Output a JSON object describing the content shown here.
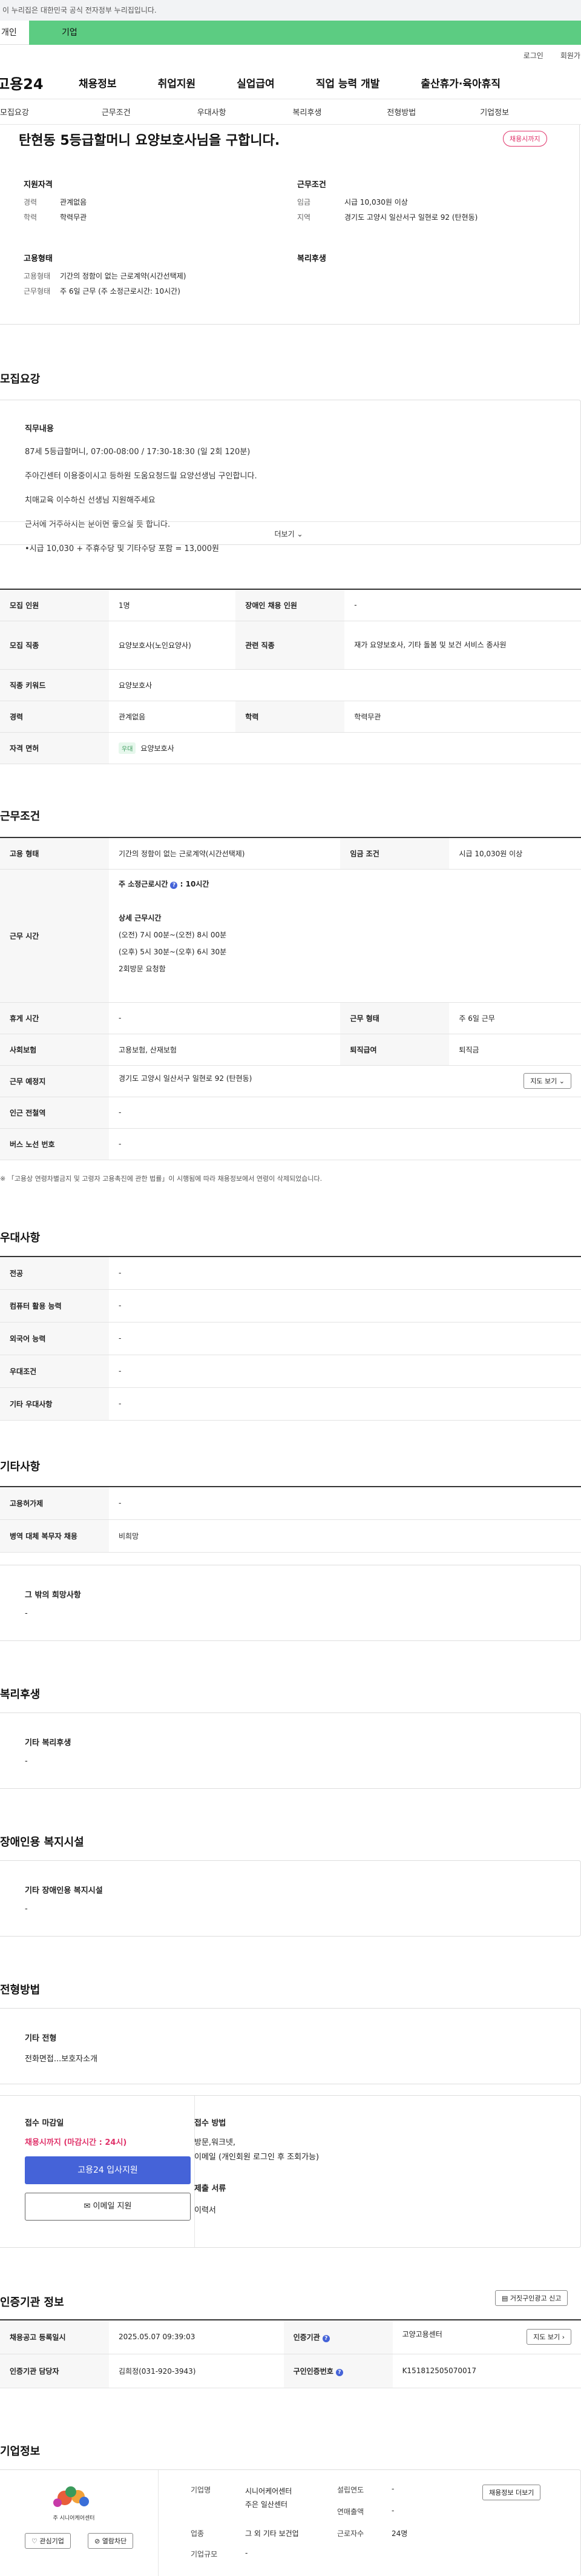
{
  "gov_banner": "이 누리집은 대한민국 공식 전자정부 누리집입니다.",
  "top_tabs": {
    "personal": "개인",
    "company": "기업"
  },
  "util": {
    "login": "로그인",
    "join": "회원가입"
  },
  "logo": "고용24",
  "gnb": [
    "채용정보",
    "취업지원",
    "실업급여",
    "직업 능력 개발",
    "출산휴가·육아휴직"
  ],
  "lnb": [
    "모집요강",
    "근무조건",
    "우대사항",
    "복리후생",
    "전형방법",
    "기업정보"
  ],
  "header": {
    "title": "탄현동 5등급할머니 요양보호사님을 구합니다.",
    "badge": "채용시까지",
    "qual_title": "지원자격",
    "career_k": "경력",
    "career_v": "관계없음",
    "edu_k": "학력",
    "edu_v": "학력무관",
    "work_title": "근무조건",
    "wage_k": "임금",
    "wage_v": "시급 10,030원 이상",
    "region_k": "지역",
    "region_v": "경기도 고양시 일산서구 일현로 92 (탄현동)",
    "emp_title": "고용형태",
    "emptype_k": "고용형태",
    "emptype_v": "기간의 정함이 없는 근로계약(시간선택제)",
    "workform_k": "근무형태",
    "workform_v": "주 6일 근무 (주 소정근로시간: 10시간)",
    "welfare_title": "복리후생"
  },
  "recruit": {
    "title": "모집요강",
    "duty_title": "직무내용",
    "lines": [
      "87세 5등급할머니, 07:00-08:00 / 17:30-18:30  (일 2회 120분)",
      "주아긴센터 이용중이시고 등하원 도움요청드릴 요양선생님 구인합니다.",
      "치매교육 이수하신 선생님 지원해주세요",
      "근처에 거주하시는 분이면 좋으실 듯 합니다.",
      "•시급 10,030 + 주휴수당 및 기타수당 포함 = 13,000원"
    ],
    "more": "더보기",
    "rows": [
      {
        "k": "모집 인원",
        "v": "1명",
        "k2": "장애인 채용 인원",
        "v2": "-"
      },
      {
        "k": "모집 직종",
        "v": "요양보호사(노인요양사)",
        "k2": "관련 직종",
        "v2": "재가 요양보호사, 기타 돌봄 및 보건 서비스 종사원"
      },
      {
        "k": "직종 키워드",
        "v": "요양보호사"
      },
      {
        "k": "경력",
        "v": "관계없음",
        "k2": "학력",
        "v2": "학력무관"
      },
      {
        "k": "자격 면허",
        "lic": "우대",
        "v": "요양보호사"
      }
    ]
  },
  "work": {
    "title": "근무조건",
    "emp_k": "고용 형태",
    "emp_v": "기간의 정함이 없는 근로계약(시간선택제)",
    "wage_k": "임금 조건",
    "wage_v": "시급 10,030원 이상",
    "time_k": "근무 시간",
    "weekly": "주 소정근로시간",
    "weekly_v": ": 10시간",
    "detail_title": "상세 근무시간",
    "detail": [
      "(오전) 7시 00분~(오전) 8시 00분",
      "(오후) 5시 30분~(오후) 6시 30분",
      "2회방문 요청함"
    ],
    "rest_k": "휴게 시간",
    "rest_v": "-",
    "form_k": "근무 형태",
    "form_v": "주 6일 근무",
    "ins_k": "사회보험",
    "ins_v": "고용보험, 산재보험",
    "ret_k": "퇴직급여",
    "ret_v": "퇴직금",
    "place_k": "근무 예정지",
    "place_v": "경기도 고양시 일산서구 일현로 92 (탄현동)",
    "map_btn": "지도 보기",
    "subway_k": "인근 전철역",
    "subway_v": "-",
    "bus_k": "버스 노선 번호",
    "bus_v": "-",
    "note": "※ 「고용상 연령차별금지 및 고령자 고용촉진에 관한 법률」이 시행됨에 따라 채용정보에서 연령이 삭제되었습니다."
  },
  "pref": {
    "title": "우대사항",
    "rows": [
      {
        "k": "전공",
        "v": "-"
      },
      {
        "k": "컴퓨터 활용 능력",
        "v": "-"
      },
      {
        "k": "외국어 능력",
        "v": "-"
      },
      {
        "k": "우대조건",
        "v": "-"
      },
      {
        "k": "기타 우대사항",
        "v": "-"
      }
    ]
  },
  "etc": {
    "title": "기타사항",
    "rows": [
      {
        "k": "고용허가제",
        "v": "-"
      },
      {
        "k": "병역 대체 복무자 채용",
        "v": "비희망"
      }
    ],
    "hope_title": "그 밖의 희망사항",
    "hope_v": "-"
  },
  "welfare": {
    "title": "복리후생",
    "sub": "기타 복리후생",
    "v": "-"
  },
  "disabled": {
    "title": "장애인용 복지시설",
    "sub": "기타 장애인용 복지시설",
    "v": "-"
  },
  "screening": {
    "title": "전형방법",
    "sub": "기타 전형",
    "v": "전화면접...보호자소개",
    "deadline_k": "접수 마감일",
    "deadline_v": "채용시까지 (마감시간 : 24시)",
    "apply_btn": "고용24 입사지원",
    "email_btn": "이메일 지원",
    "method_k": "접수 방법",
    "method_v1": "방문,워크넷,",
    "method_v2": "이메일 (개인회원 로그인 후 조회가능)",
    "docs_k": "제출 서류",
    "docs_v": "이력서"
  },
  "auth": {
    "title": "인증기관 정보",
    "report_btn": "거짓구인광고 신고",
    "reg_k": "채용공고 등록일시",
    "reg_v": "2025.05.07 09:39:03",
    "org_k": "인증기관",
    "org_v": "고양고용센터",
    "map_btn": "지도 보기",
    "mgr_k": "인증기관 담당자",
    "mgr_v": "김희정(031-920-3943)",
    "auth_k": "구인인증번호",
    "auth_v": "K151812505070017"
  },
  "company": {
    "title": "기업정보",
    "name_k": "기업명",
    "name_v1": "시니어케어센터",
    "name_v2": "주은 일산센터",
    "industry_k": "업종",
    "industry_v": "그 외 기타 보건업",
    "size_k": "기업규모",
    "size_v": "-",
    "year_k": "설립연도",
    "year_v": "-",
    "sales_k": "연매출액",
    "sales_v": "-",
    "emp_k": "근로자수",
    "emp_v": "24명",
    "jobs_btn": "채용정보 더보기",
    "fav_btn": "관심기업",
    "block_btn": "열람차단",
    "logo_text": "주 시니어케어센터",
    "logo_sub": "SENIOR CARE"
  }
}
